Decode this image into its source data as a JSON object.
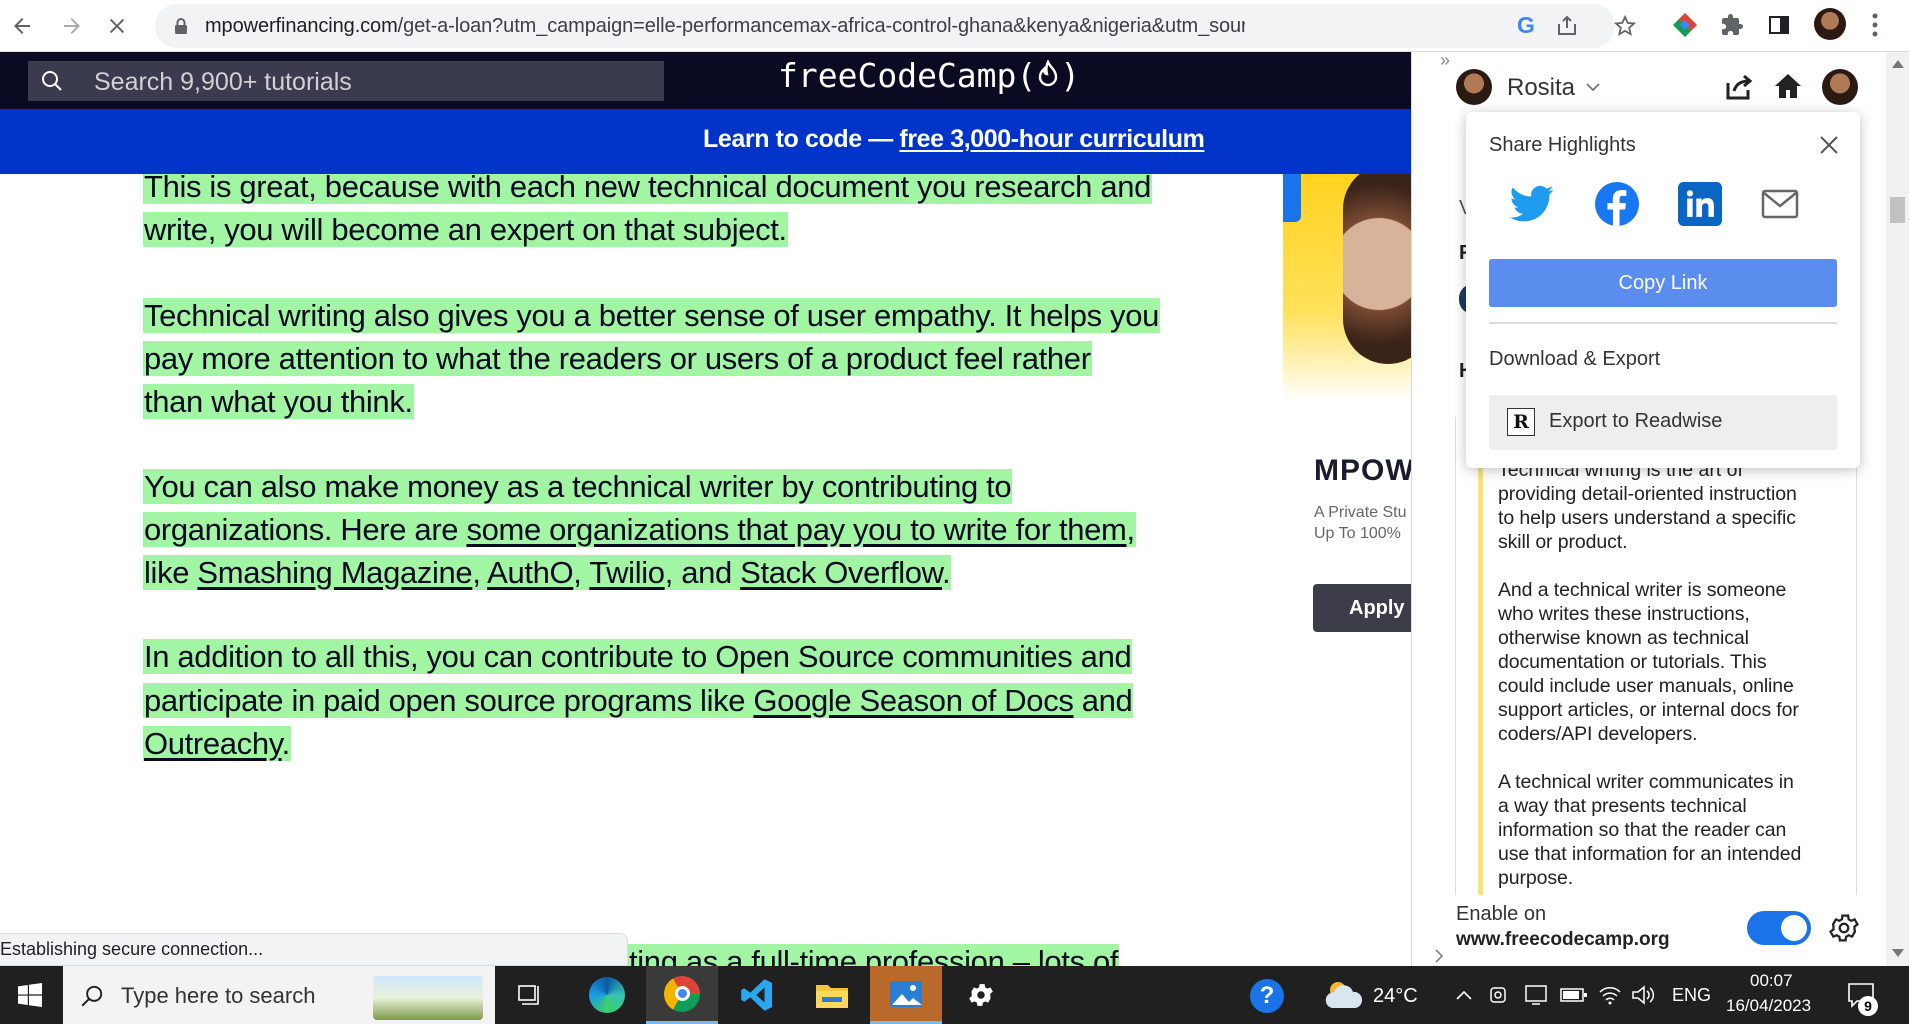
{
  "browser": {
    "url_domain": "mpowerfinancing.com",
    "url_path": "/get-a-loan?utm_campaign=elle-performancemax-africa-control-ghana&kenya&nigeria&utm_source=google&utm..."
  },
  "fcc": {
    "search_placeholder": "Search 9,900+ tutorials",
    "logo": "freeCodeCamp(",
    "logo_end": ")",
    "banner_text": "Learn to code — ",
    "banner_link": "free 3,000-hour curriculum"
  },
  "article": {
    "p1_l1": "This is great, because with each new technical document you research and",
    "p1_l2": "write, you will become an expert on that subject.",
    "p2_l1": "Technical writing also gives you a better sense of user empathy. It helps you",
    "p2_l2": "pay more attention to what the readers or users of a product feel rather",
    "p2_l3": "than what you think.",
    "p3_l1": "You can also make money as a technical writer by contributing to",
    "p3_l2a": "organizations. Here are ",
    "p3_l2_link": "some organizations that pay you to write for them",
    "p3_l2b": ",",
    "p3_l3a": "like ",
    "p3_l3_link1": "Smashing Magazine",
    "p3_l3_sep1": ", ",
    "p3_l3_link2": "AuthO",
    "p3_l3_sep2": ", ",
    "p3_l3_link3": "Twilio",
    "p3_l3_sep3": ", and ",
    "p3_l3_link4": "Stack Overflow",
    "p3_l3_end": ".",
    "p4_l1": "In addition to all this, you can contribute to Open Source communities and",
    "p4_l2a": "participate in paid open source programs like ",
    "p4_l2_link": "Google Season of Docs",
    "p4_l2b": " and",
    "p4_l3_link": "Outreachy",
    "p4_l3_end": ".",
    "p5_partial": "ting as a full-time profession – lots of"
  },
  "status_bar": "Establishing secure connection...",
  "ad": {
    "brand": "MPOW",
    "line1": "A Private Stu",
    "line2": "Up To 100%",
    "apply": "Apply"
  },
  "readwise": {
    "user": "Rosita",
    "share_title": "Share Highlights",
    "copy_link": "Copy Link",
    "download_title": "Download & Export",
    "export_readwise": "Export to Readwise",
    "export_icon_letter": "R",
    "side_letter_v": "V",
    "side_letter_f": "F",
    "side_letter_h": "H",
    "highlight_partial": "Technical writing is the art of",
    "hl1": [
      "providing detail-oriented instruction",
      "to help users understand a specific",
      "skill or product."
    ],
    "hl2": [
      "And a technical writer is someone",
      "who writes these instructions,",
      "otherwise known as technical",
      "documentation or tutorials. This",
      "could include user manuals, online",
      "support articles, or internal docs for",
      "coders/API developers."
    ],
    "hl3": [
      "A technical writer communicates in",
      "a way that presents technical",
      "information so that the reader can",
      "use that information for an intended",
      "purpose."
    ],
    "enable_label": "Enable on",
    "enable_site": "www.freecodecamp.org",
    "enabled": true
  },
  "taskbar": {
    "search_placeholder": "Type here to search",
    "temperature": "24°C",
    "language": "ENG",
    "time": "00:07",
    "date": "16/04/2023",
    "notifications": "9"
  },
  "colors": {
    "fcc_nav": "#0a0a23",
    "fcc_banner": "#0033c7",
    "highlight": "#a1f5a3",
    "copy_link_button": "#5b8def",
    "toggle_on": "#1a73e8"
  }
}
